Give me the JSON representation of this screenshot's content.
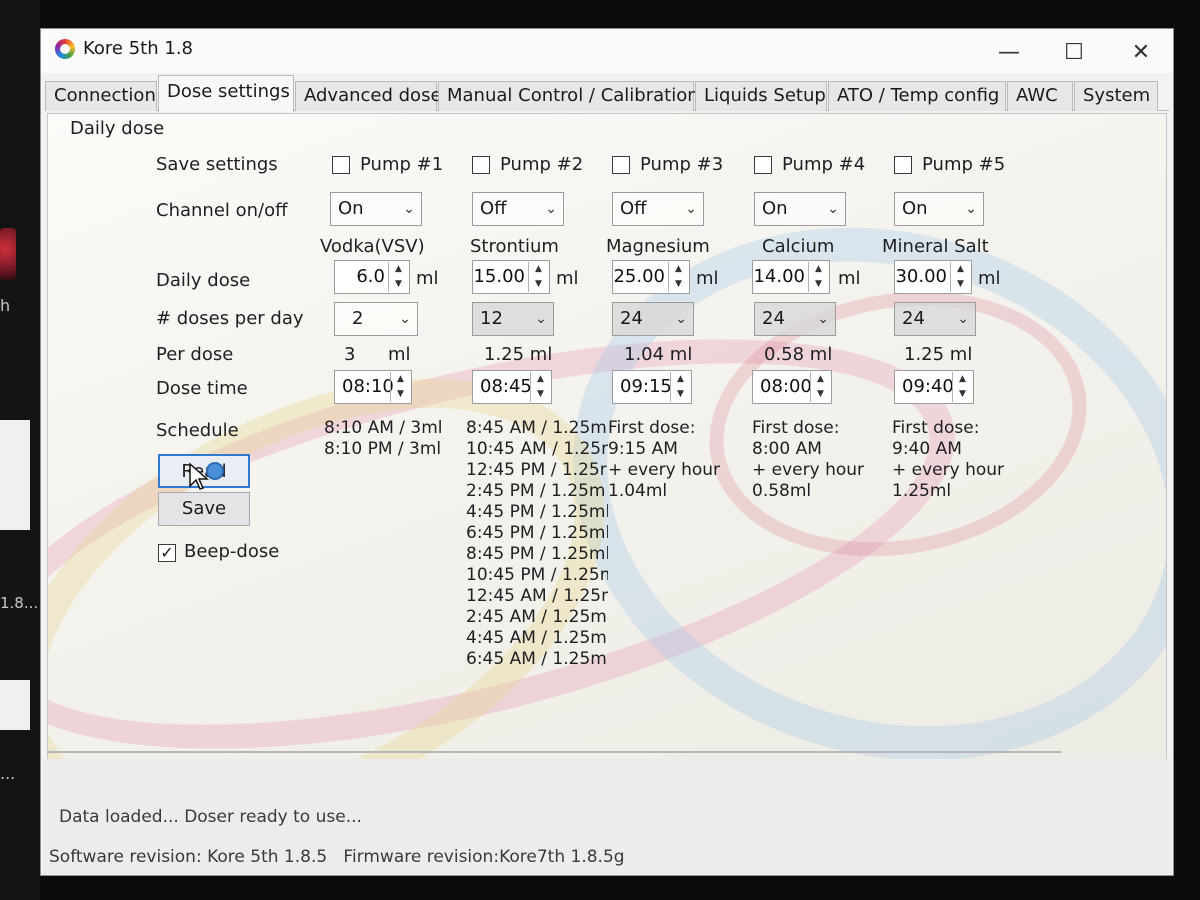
{
  "desktop": {
    "text1": "h",
    "text2": "1.8...",
    "text3": "..."
  },
  "window": {
    "title": "Kore 5th 1.8",
    "minimize_glyph": "—",
    "maximize_glyph": "☐",
    "close_glyph": "✕"
  },
  "tabs": [
    "Connection",
    "Dose settings",
    "Advanced dose",
    "Manual Control / Calibration",
    "Liquids Setup",
    "ATO / Temp config",
    "AWC",
    "System"
  ],
  "panel": {
    "group_label": "Daily dose",
    "row_labels": {
      "save_settings": "Save settings",
      "channel": "Channel on/off",
      "daily_dose": "Daily dose",
      "doses_per_day": "# doses per day",
      "per_dose": "Per dose",
      "dose_time": "Dose time",
      "schedule": "Schedule"
    },
    "unit": "ml",
    "pumps": [
      {
        "name": "Pump #1",
        "checked": false,
        "channel": "On",
        "liquid": "Vodka(VSV)",
        "daily_dose": "6.0",
        "doses_per_day": "2",
        "per_dose": "3",
        "per_dose_unit": "ml",
        "dose_time": "08:10",
        "schedule": "8:10 AM / 3ml\n8:10 PM / 3ml"
      },
      {
        "name": "Pump #2",
        "checked": false,
        "channel": "Off",
        "liquid": "Strontium",
        "daily_dose": "15.00",
        "doses_per_day": "12",
        "per_dose": "1.25 ml",
        "dose_time": "08:45",
        "schedule": "8:45 AM / 1.25m\n10:45 AM / 1.25r\n12:45 PM / 1.25r\n2:45 PM / 1.25m\n4:45 PM / 1.25ml\n6:45 PM / 1.25ml\n8:45 PM / 1.25ml\n10:45 PM / 1.25ml\n12:45 AM / 1.25ml\n2:45 AM / 1.25ml\n4:45 AM / 1.25ml\n6:45 AM / 1.25ml"
      },
      {
        "name": "Pump #3",
        "checked": false,
        "channel": "Off",
        "liquid": "Magnesium",
        "daily_dose": "25.00",
        "doses_per_day": "24",
        "per_dose": "1.04 ml",
        "dose_time": "09:15",
        "schedule": "First dose:\n9:15 AM\n+ every hour\n1.04ml"
      },
      {
        "name": "Pump #4",
        "checked": false,
        "channel": "On",
        "liquid": "Calcium",
        "daily_dose": "14.00",
        "doses_per_day": "24",
        "per_dose": "0.58 ml",
        "dose_time": "08:00",
        "schedule": "First dose:\n8:00 AM\n+ every hour\n0.58ml"
      },
      {
        "name": "Pump #5",
        "checked": false,
        "channel": "On",
        "liquid": "Mineral Salt",
        "daily_dose": "30.00",
        "doses_per_day": "24",
        "per_dose": "1.25 ml",
        "dose_time": "09:40",
        "schedule": "First dose:\n9:40 AM\n+ every hour\n1.25ml"
      }
    ],
    "read_button": "Read",
    "save_button": "Save",
    "beep_label": "Beep-dose",
    "beep_checked": true,
    "check_glyph": "✓",
    "arrow_glyph": "⌄",
    "spin_up": "▲",
    "spin_down": "▼"
  },
  "status": {
    "message": "Data loaded... Doser ready to use...",
    "software": "Software revision: Kore 5th  1.8.5",
    "firmware": "Firmware revision:Kore7th  1.8.5g"
  },
  "colors": {
    "accent": "#2f7ad0",
    "window_bg": "#f2f2f3",
    "wave_pink": "#e8a0b8",
    "wave_blue": "#a8c8e8",
    "wave_yellow": "#e8d890"
  }
}
